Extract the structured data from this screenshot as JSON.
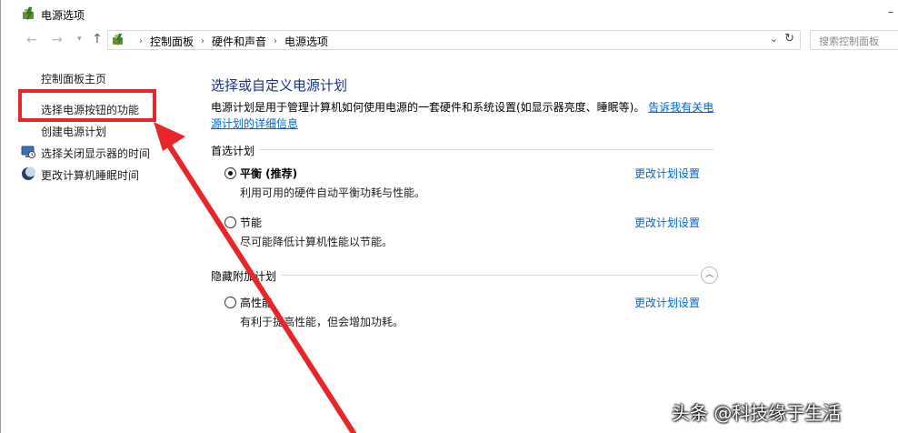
{
  "window": {
    "title": "电源选项",
    "minimize_glyph": "–"
  },
  "nav": {
    "back_icon": "arrow-left-icon",
    "forward_icon": "arrow-right-icon",
    "recent_icon": "chevron-down-icon",
    "up_icon": "arrow-up-icon",
    "breadcrumbs": [
      "控制面板",
      "硬件和声音",
      "电源选项"
    ],
    "search_placeholder": "搜索控制面板"
  },
  "sidebar": {
    "home": "控制面板主页",
    "items": [
      {
        "label": "选择电源按钮的功能"
      },
      {
        "label": "创建电源计划"
      },
      {
        "label": "选择关闭显示器的时间",
        "icon": "display-icon"
      },
      {
        "label": "更改计算机睡眠时间",
        "icon": "moon-icon"
      }
    ]
  },
  "main": {
    "heading": "选择或自定义电源计划",
    "description": "电源计划是用于管理计算机如何使用电源的一套硬件和系统设置(如显示器亮度、睡眠等)。",
    "description_link": "告诉我有关电源计划的详细信息",
    "preferred_label": "首选计划",
    "hidden_label": "隐藏附加计划",
    "plans": [
      {
        "name": "平衡 (推荐)",
        "desc": "利用可用的硬件自动平衡功耗与性能。",
        "link": "更改计划设置",
        "selected": true
      },
      {
        "name": "节能",
        "desc": "尽可能降低计算机性能以节能。",
        "link": "更改计划设置",
        "selected": false
      },
      {
        "name": "高性能",
        "desc": "有利于提高性能，但会增加功耗。",
        "link": "更改计划设置",
        "selected": false
      }
    ]
  },
  "annotation": {
    "color": "#e8262a"
  },
  "watermark": "头条 @科技缘于生活",
  "colors": {
    "heading": "#1e3287",
    "link": "#0066cc"
  }
}
